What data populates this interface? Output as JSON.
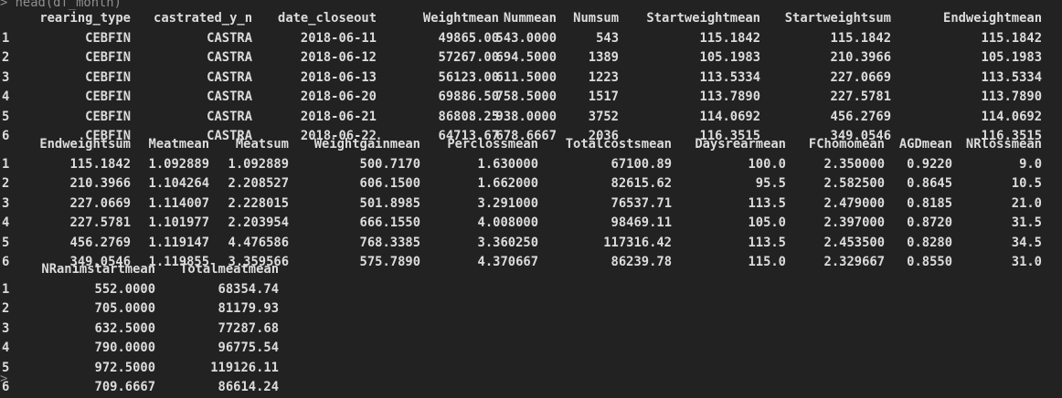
{
  "console": {
    "prompt": ">",
    "command": "head(df_month)",
    "next_prompt": ">"
  },
  "blocks": [
    {
      "columns": [
        {
          "header": "",
          "align": "left"
        },
        {
          "header": "rearing_type",
          "align": "right"
        },
        {
          "header": "castrated_y_n",
          "align": "right"
        },
        {
          "header": "date_closeout",
          "align": "right"
        },
        {
          "header": "Weightmean",
          "align": "right"
        },
        {
          "header": "Nummean",
          "align": "right"
        },
        {
          "header": "Numsum",
          "align": "right"
        },
        {
          "header": "Startweightmean",
          "align": "right"
        },
        {
          "header": "Startweightsum",
          "align": "right"
        },
        {
          "header": "Endweightmean",
          "align": "right"
        }
      ],
      "rows": [
        [
          "1",
          "CEBFIN",
          "CASTRA",
          "2018-06-11",
          "49865.00",
          "543.0000",
          "543",
          "115.1842",
          "115.1842",
          "115.1842"
        ],
        [
          "2",
          "CEBFIN",
          "CASTRA",
          "2018-06-12",
          "57267.00",
          "694.5000",
          "1389",
          "105.1983",
          "210.3966",
          "105.1983"
        ],
        [
          "3",
          "CEBFIN",
          "CASTRA",
          "2018-06-13",
          "56123.00",
          "611.5000",
          "1223",
          "113.5334",
          "227.0669",
          "113.5334"
        ],
        [
          "4",
          "CEBFIN",
          "CASTRA",
          "2018-06-20",
          "69886.50",
          "758.5000",
          "1517",
          "113.7890",
          "227.5781",
          "113.7890"
        ],
        [
          "5",
          "CEBFIN",
          "CASTRA",
          "2018-06-21",
          "86808.25",
          "938.0000",
          "3752",
          "114.0692",
          "456.2769",
          "114.0692"
        ],
        [
          "6",
          "CEBFIN",
          "CASTRA",
          "2018-06-22",
          "64713.67",
          "678.6667",
          "2036",
          "116.3515",
          "349.0546",
          "116.3515"
        ]
      ]
    },
    {
      "columns": [
        {
          "header": "",
          "align": "left"
        },
        {
          "header": "Endweightsum",
          "align": "right"
        },
        {
          "header": "Meatmean",
          "align": "right"
        },
        {
          "header": "Meatsum",
          "align": "right"
        },
        {
          "header": "Weightgainmean",
          "align": "right"
        },
        {
          "header": "Perclossmean",
          "align": "right"
        },
        {
          "header": "Totalcostsmean",
          "align": "right"
        },
        {
          "header": "Daysrearmean",
          "align": "right"
        },
        {
          "header": "FChomomean",
          "align": "right"
        },
        {
          "header": "AGDmean",
          "align": "right"
        },
        {
          "header": "NRlossmean",
          "align": "right"
        }
      ],
      "rows": [
        [
          "1",
          "115.1842",
          "1.092889",
          "1.092889",
          "500.7170",
          "1.630000",
          "67100.89",
          "100.0",
          "2.350000",
          "0.9220",
          "9.0"
        ],
        [
          "2",
          "210.3966",
          "1.104264",
          "2.208527",
          "606.1500",
          "1.662000",
          "82615.62",
          "95.5",
          "2.582500",
          "0.8645",
          "10.5"
        ],
        [
          "3",
          "227.0669",
          "1.114007",
          "2.228015",
          "501.8985",
          "3.291000",
          "76537.71",
          "113.5",
          "2.479000",
          "0.8185",
          "21.0"
        ],
        [
          "4",
          "227.5781",
          "1.101977",
          "2.203954",
          "666.1550",
          "4.008000",
          "98469.11",
          "105.0",
          "2.397000",
          "0.8720",
          "31.5"
        ],
        [
          "5",
          "456.2769",
          "1.119147",
          "4.476586",
          "768.3385",
          "3.360250",
          "117316.42",
          "113.5",
          "2.453500",
          "0.8280",
          "34.5"
        ],
        [
          "6",
          "349.0546",
          "1.119855",
          "3.359566",
          "575.7890",
          "4.370667",
          "86239.78",
          "115.0",
          "2.329667",
          "0.8550",
          "31.0"
        ]
      ]
    },
    {
      "columns": [
        {
          "header": "",
          "align": "left"
        },
        {
          "header": "NRanimstartmean",
          "align": "right"
        },
        {
          "header": "Totalmeatmean",
          "align": "right"
        }
      ],
      "rows": [
        [
          "1",
          "552.0000",
          "68354.74"
        ],
        [
          "2",
          "705.0000",
          "81179.93"
        ],
        [
          "3",
          "632.5000",
          "77287.68"
        ],
        [
          "4",
          "790.0000",
          "96775.54"
        ],
        [
          "5",
          "972.5000",
          "119126.11"
        ],
        [
          "6",
          "709.6667",
          "86614.24"
        ]
      ]
    }
  ]
}
